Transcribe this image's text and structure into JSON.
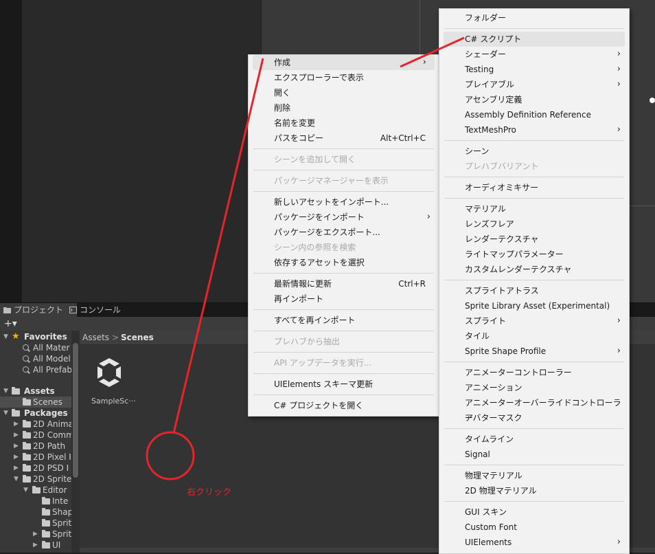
{
  "tabs": [
    {
      "label": "プロジェクト",
      "active": true,
      "icon": "folder-icon"
    },
    {
      "label": "コンソール",
      "active": false,
      "icon": "console-icon"
    }
  ],
  "toolbar": {
    "plus": "+▾"
  },
  "tree": {
    "favorites_label": "Favorites",
    "favorites": [
      "All Mater",
      "All Model",
      "All Prefab"
    ],
    "assets_label": "Assets",
    "scenes_label": "Scenes",
    "packages_label": "Packages",
    "packages": [
      "2D Anima",
      "2D Comm",
      "2D Path",
      "2D Pixel I",
      "2D PSD I",
      "2D Sprite"
    ],
    "sprite_children": [
      "Editor"
    ],
    "editor_children": [
      "Inte",
      "Shap",
      "Sprit",
      "Sprit",
      "UI"
    ]
  },
  "breadcrumb": {
    "root": "Assets",
    "separator": ">",
    "current": "Scenes"
  },
  "asset": {
    "label": "SampleSc···"
  },
  "menu_main": [
    {
      "label": "作成",
      "submenu": true,
      "highlight": true
    },
    {
      "label": "エクスプローラーで表示"
    },
    {
      "label": "開く"
    },
    {
      "label": "削除"
    },
    {
      "label": "名前を変更"
    },
    {
      "label": "パスをコピー",
      "shortcut": "Alt+Ctrl+C"
    },
    {
      "sep": true
    },
    {
      "label": "シーンを追加して開く",
      "disabled": true
    },
    {
      "sep": true
    },
    {
      "label": "パッケージマネージャーを表示",
      "disabled": true
    },
    {
      "sep": true
    },
    {
      "label": "新しいアセットをインポート..."
    },
    {
      "label": "パッケージをインポート",
      "submenu": true
    },
    {
      "label": "パッケージをエクスポート..."
    },
    {
      "label": "シーン内の参照を検索",
      "disabled": true
    },
    {
      "label": "依存するアセットを選択"
    },
    {
      "sep": true
    },
    {
      "label": "最新情報に更新",
      "shortcut": "Ctrl+R"
    },
    {
      "label": "再インポート"
    },
    {
      "sep": true
    },
    {
      "label": "すべてを再インポート"
    },
    {
      "sep": true
    },
    {
      "label": "プレハブから抽出",
      "disabled": true
    },
    {
      "sep": true
    },
    {
      "label": "API アップデータを実行...",
      "disabled": true
    },
    {
      "sep": true
    },
    {
      "label": "UIElements スキーマ更新"
    },
    {
      "sep": true
    },
    {
      "label": "C# プロジェクトを開く"
    }
  ],
  "menu_create": [
    {
      "label": "フォルダー"
    },
    {
      "sep": true
    },
    {
      "label": "C# スクリプト",
      "highlight": true
    },
    {
      "label": "シェーダー",
      "submenu": true
    },
    {
      "label": "Testing",
      "submenu": true
    },
    {
      "label": "プレイアブル",
      "submenu": true
    },
    {
      "label": "アセンブリ定義"
    },
    {
      "label": "Assembly Definition Reference"
    },
    {
      "label": "TextMeshPro",
      "submenu": true
    },
    {
      "sep": true
    },
    {
      "label": "シーン"
    },
    {
      "label": "プレハブバリアント",
      "disabled": true
    },
    {
      "sep": true
    },
    {
      "label": "オーディオミキサー"
    },
    {
      "sep": true
    },
    {
      "label": "マテリアル"
    },
    {
      "label": "レンズフレア"
    },
    {
      "label": "レンダーテクスチャ"
    },
    {
      "label": "ライトマップパラメーター"
    },
    {
      "label": "カスタムレンダーテクスチャ"
    },
    {
      "sep": true
    },
    {
      "label": "スプライトアトラス"
    },
    {
      "label": "Sprite Library Asset (Experimental)"
    },
    {
      "label": "スプライト",
      "submenu": true
    },
    {
      "label": "タイル"
    },
    {
      "label": "Sprite Shape Profile",
      "submenu": true
    },
    {
      "sep": true
    },
    {
      "label": "アニメーターコントローラー"
    },
    {
      "label": "アニメーション"
    },
    {
      "label": "アニメーターオーバーライドコントローラー"
    },
    {
      "label": "アバターマスク"
    },
    {
      "sep": true
    },
    {
      "label": "タイムライン"
    },
    {
      "label": "Signal"
    },
    {
      "sep": true
    },
    {
      "label": "物理マテリアル"
    },
    {
      "label": "2D 物理マテリアル"
    },
    {
      "sep": true
    },
    {
      "label": "GUI スキン"
    },
    {
      "label": "Custom Font"
    },
    {
      "label": "UIElements",
      "submenu": true
    }
  ],
  "annotation": {
    "text": "右クリック",
    "color": "#e8232b"
  },
  "colors": {
    "menu_bg": "#f2f2f2",
    "highlight": "#e3e3e3",
    "editor_bg": "#383838",
    "accent_star": "#f0b400"
  }
}
